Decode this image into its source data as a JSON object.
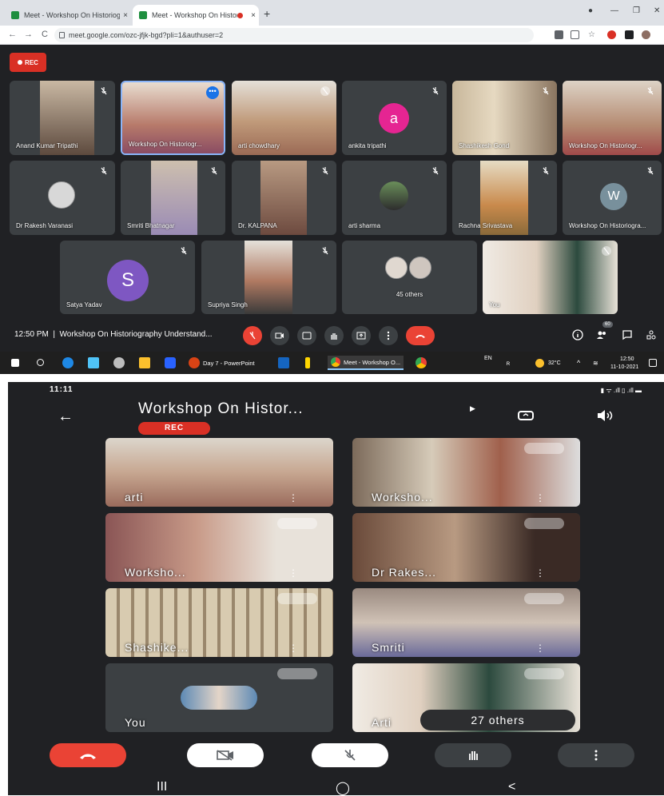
{
  "desktop": {
    "tabs": [
      {
        "title": "Meet - Workshop On Historiogr",
        "close": "×"
      },
      {
        "title": "Meet - Workshop On Histori",
        "close": "×"
      }
    ],
    "new_tab": "+",
    "window_controls": [
      "—",
      "❐",
      "✕"
    ],
    "nav": {
      "back": "←",
      "forward": "→",
      "reload": "C"
    },
    "url": "meet.google.com/ozc-jfjk-bgd?pli=1&authuser=2",
    "rec_label": "REC",
    "tiles": [
      {
        "name": "Anand Kumar Tripathi"
      },
      {
        "name": "Workshop On Historiogr..."
      },
      {
        "name": "arti chowdhary"
      },
      {
        "name": "ankita tripathi",
        "initial": "a"
      },
      {
        "name": "Shashikesh Gond"
      },
      {
        "name": "Workshop On Historiogr..."
      },
      {
        "name": "Dr Rakesh Varanasi"
      },
      {
        "name": "Smriti Bhatnagar"
      },
      {
        "name": "Dr. KALPANA"
      },
      {
        "name": "arti sharma"
      },
      {
        "name": "Rachna Srivastava"
      },
      {
        "name": "Workshop On Historiogra...",
        "initial": "W"
      },
      {
        "name": "Satya Yadav",
        "initial": "S"
      },
      {
        "name": "Supriya Singh"
      },
      {
        "name": "45 others"
      },
      {
        "name": "You"
      }
    ],
    "bottom": {
      "time": "12:50 PM",
      "divider": "|",
      "meeting_title": "Workshop On Historiography Understand...",
      "participants_count": "60"
    },
    "taskbar": {
      "items": [
        "Day 7 - PowerPoint",
        "Meet - Workshop O..."
      ],
      "lang": "EN",
      "temp": "32°C",
      "clock_time": "12:50",
      "clock_date": "11-10-2021"
    },
    "colors": {
      "bg": "#202124",
      "tile": "#3c4043",
      "red": "#ea4335",
      "pinned": "#8ab4f8"
    }
  },
  "phone": {
    "status_time": "11:11",
    "title": "Workshop On Histor...",
    "rec_label": "REC",
    "back_icon": "←",
    "tiles": [
      {
        "name": "arti"
      },
      {
        "name": "Worksho..."
      },
      {
        "name": "Worksho..."
      },
      {
        "name": "Dr Rakes..."
      },
      {
        "name": "Shashike..."
      },
      {
        "name": "Smriti"
      },
      {
        "name": "You"
      },
      {
        "name": "Arti"
      }
    ],
    "others": "27 others",
    "nav": {
      "recents": "III",
      "home": "◯",
      "back": "<"
    }
  }
}
